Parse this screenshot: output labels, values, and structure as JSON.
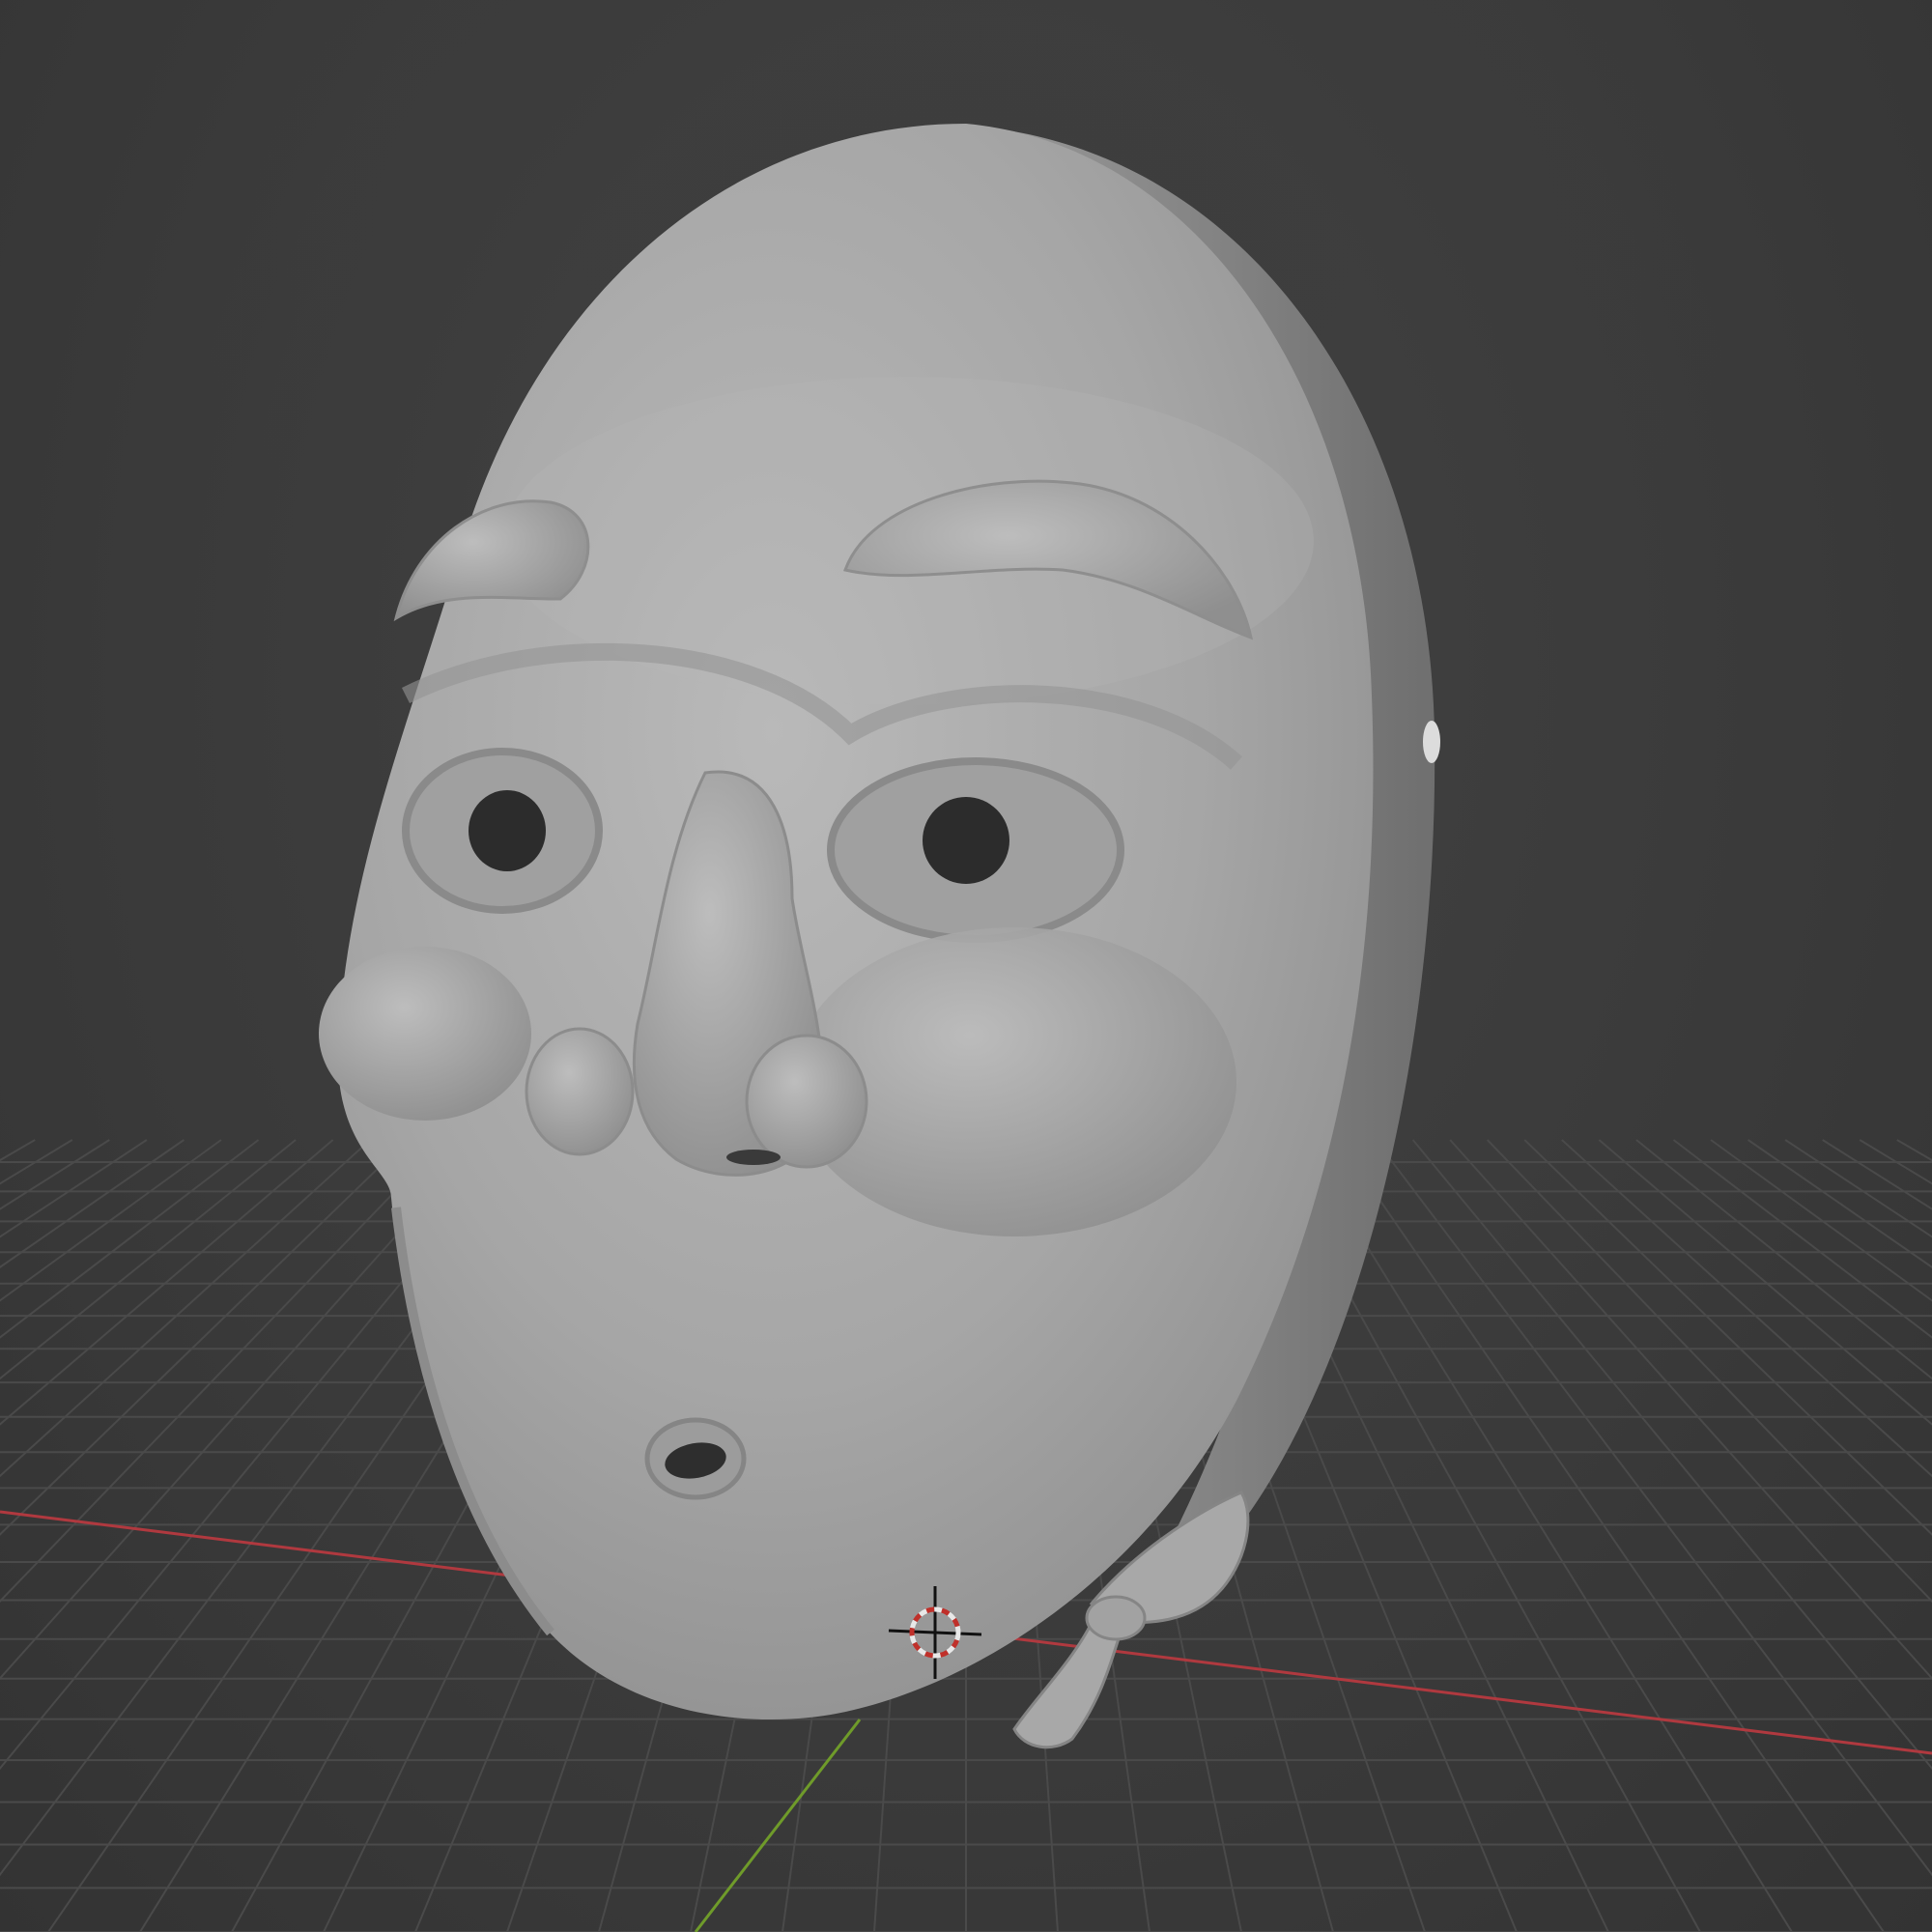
{
  "app": "3D viewport",
  "viewport": {
    "shading": "solid",
    "background": "#3d3d3d",
    "grid_color": "#4a4a4a",
    "x_axis_color": "#b0393f",
    "y_axis_color": "#6f9b2a",
    "mesh_color": "#a9a9a9"
  },
  "scene": {
    "object": "mask-mesh",
    "cursor_icon": "3d-cursor-icon"
  }
}
